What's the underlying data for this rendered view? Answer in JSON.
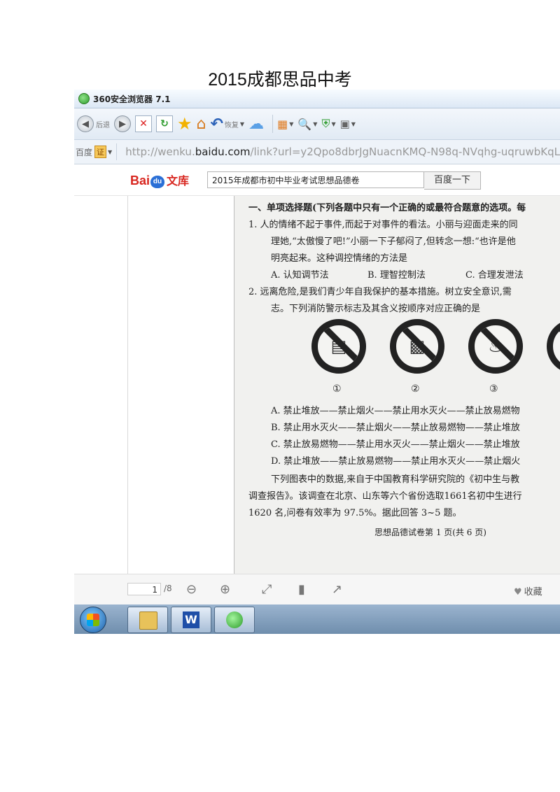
{
  "document_title": "2015成都思品中考",
  "browser": {
    "title": "360安全浏览器 7.1",
    "toolbar": {
      "back_label": "后退",
      "undo_label": "恢复"
    },
    "search_engine": "百度",
    "cert_badge": "证",
    "url_prefix": "http://wenku.",
    "url_domain": "baidu.com",
    "url_rest": "/link?url=y2Qpo8dbrJgNuacnKMQ-N98q-NVqhg-uqruwbKqL"
  },
  "baidu": {
    "logo_left": "Bai",
    "logo_paw": "du",
    "logo_right": "文库",
    "search_value": "2015年成都市初中毕业考试思想品德卷",
    "submit_label": "百度一下"
  },
  "page": {
    "section_heading": "一、单项选择题(下列各题中只有一个正确的或最符合题意的选项。每",
    "q1_line1": "1.   人的情绪不起于事件,而起于对事件的看法。小丽与迎面走来的同",
    "q1_line2": "理她,“太傲慢了吧!”小丽一下子郁闷了,但转念一想:“也许是他",
    "q1_line3": "明亮起来。这种调控情绪的方法是",
    "q1_opt_a": "A. 认知调节法",
    "q1_opt_b": "B. 理智控制法",
    "q1_opt_c": "C. 合理发泄法",
    "q2_line1": "2.   远离危险,是我们青少年自我保护的基本措施。树立安全意识,需",
    "q2_line2": "志。下列消防警示标志及其含义按顺序对应正确的是",
    "sign_labels": [
      "①",
      "②",
      "③"
    ],
    "q2_opt_a": "A. 禁止堆放——禁止烟火——禁止用水灭火——禁止放易燃物",
    "q2_opt_b": "B. 禁止用水灭火——禁止烟火——禁止放易燃物——禁止堆放",
    "q2_opt_c": "C. 禁止放易燃物——禁止用水灭火——禁止烟火——禁止堆放",
    "q2_opt_d": "D. 禁止堆放——禁止放易燃物——禁止用水灭火——禁止烟火",
    "para_line1": "下列图表中的数据,来自于中国教育科学研究院的《初中生与教",
    "para_line2": "调查报告》。该调查在北京、山东等六个省份选取1661名初中生进行",
    "para_line3": "1620 名,问卷有效率为 97.5%。据此回答 3~5 题。",
    "footer": "思想品德试卷第 1 页(共 6 页)"
  },
  "viewer": {
    "current_page": "1",
    "total_pages": "/8",
    "favorite_label": "收藏"
  }
}
